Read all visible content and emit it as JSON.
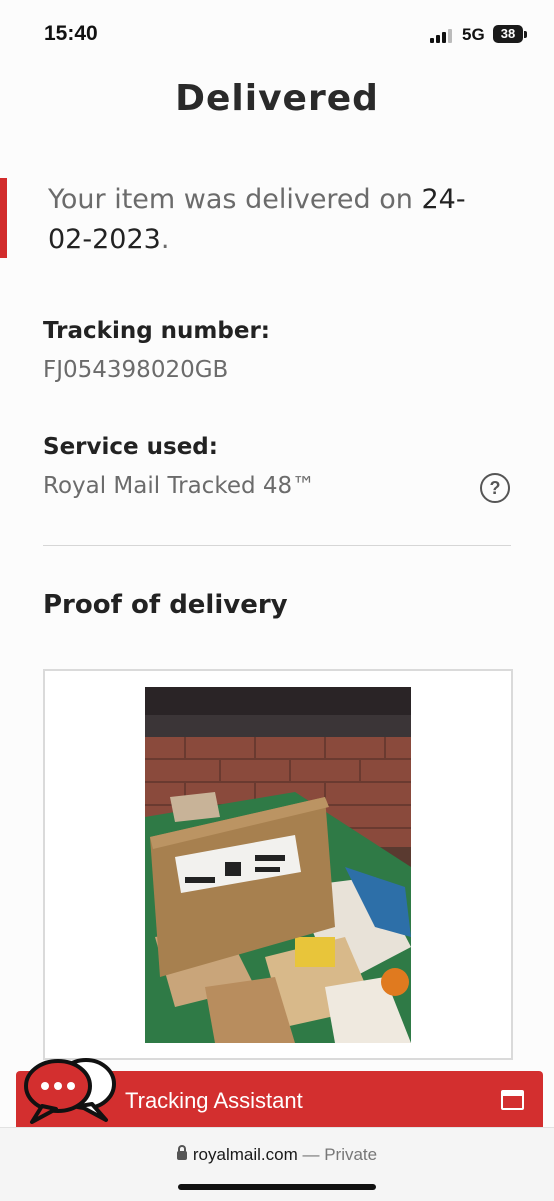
{
  "status_bar": {
    "time": "15:40",
    "network": "5G",
    "battery": "38"
  },
  "page": {
    "title": "Delivered"
  },
  "delivery": {
    "prefix": "Your item was delivered on ",
    "date": "24-02-2023",
    "suffix": "."
  },
  "tracking": {
    "label": "Tracking number:",
    "value": "FJ054398020GB"
  },
  "service": {
    "label": "Service used:",
    "value": "Royal Mail Tracked 48™",
    "help_icon": "question-icon"
  },
  "proof": {
    "title": "Proof of delivery",
    "image": "delivery-photo"
  },
  "assistant": {
    "label": "Tracking Assistant",
    "chat_icon": "chat-bubbles-icon",
    "expand_icon": "window-icon"
  },
  "browser": {
    "domain": "royalmail.com",
    "separator": " — ",
    "mode": "Private"
  },
  "colors": {
    "accent": "#d32f2f",
    "text": "#2a2a2a",
    "muted": "#6b6b6b"
  }
}
